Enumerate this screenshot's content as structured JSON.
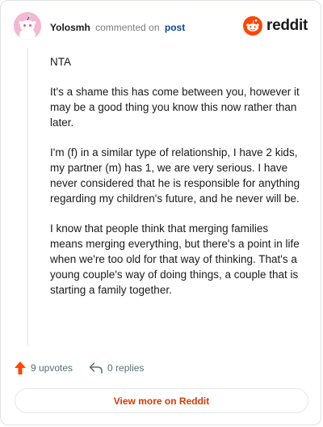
{
  "header": {
    "username": "Yolosmh",
    "action_text": "commented on",
    "post_link": "post",
    "brand": "reddit"
  },
  "comment": {
    "paragraphs": [
      "NTA",
      "It's a shame this has come between you, however it may be a good thing you know this now rather than later.",
      "I'm (f) in a similar type of relationship, I have 2 kids, my partner (m) has 1, we are very serious. I have never considered that he is responsible for anything regarding my children's future, and he never will be.",
      "I know that people think that merging families means merging everything, but there's a point in life when we're too old for that way of thinking. That's a young couple's way of doing things, a couple that is starting a family together."
    ]
  },
  "actions": {
    "upvotes": "9 upvotes",
    "replies": "0 replies"
  },
  "footer": {
    "view_more": "View more on Reddit"
  },
  "colors": {
    "brand_orange": "#ff4500",
    "link_blue": "#0a449b",
    "cta_text": "#d93a00",
    "avatar_bg": "#f3b8d3"
  },
  "icons": [
    "avatar-snoo-icon",
    "reddit-logo-icon",
    "upvote-arrow-icon",
    "reply-arrow-icon"
  ]
}
